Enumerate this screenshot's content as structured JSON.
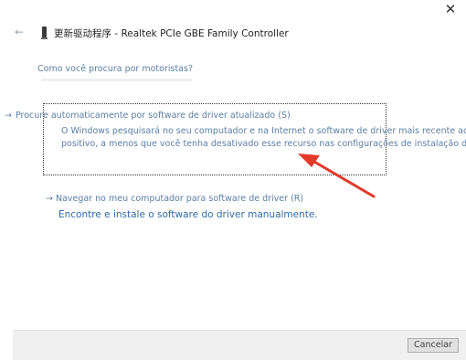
{
  "window": {
    "title": "更新驱动程序 - Realtek PCIe GBE Family Controller",
    "close_glyph": "✕",
    "back_glyph": "←"
  },
  "main": {
    "question": "Como você procura por motoristas?",
    "auto": {
      "arrow": "→",
      "title": "Procure automaticamente por software de driver atualizado (S)",
      "desc_line1": "O Windows pesquisará no seu computador e na Internet o software de driver mais recente adeq",
      "desc_line2": "positivo, a menos que você tenha desativado esse recurso nas configurações de instalação do"
    },
    "manual": {
      "title": "→  Navegar no meu computador para software de driver (R)",
      "desc": "Encontre e instale o software do driver manualmente."
    }
  },
  "footer": {
    "cancel_label": "Cancelar"
  },
  "colors": {
    "link": "#5a7ea6",
    "annotation_arrow": "#e23a2b"
  }
}
